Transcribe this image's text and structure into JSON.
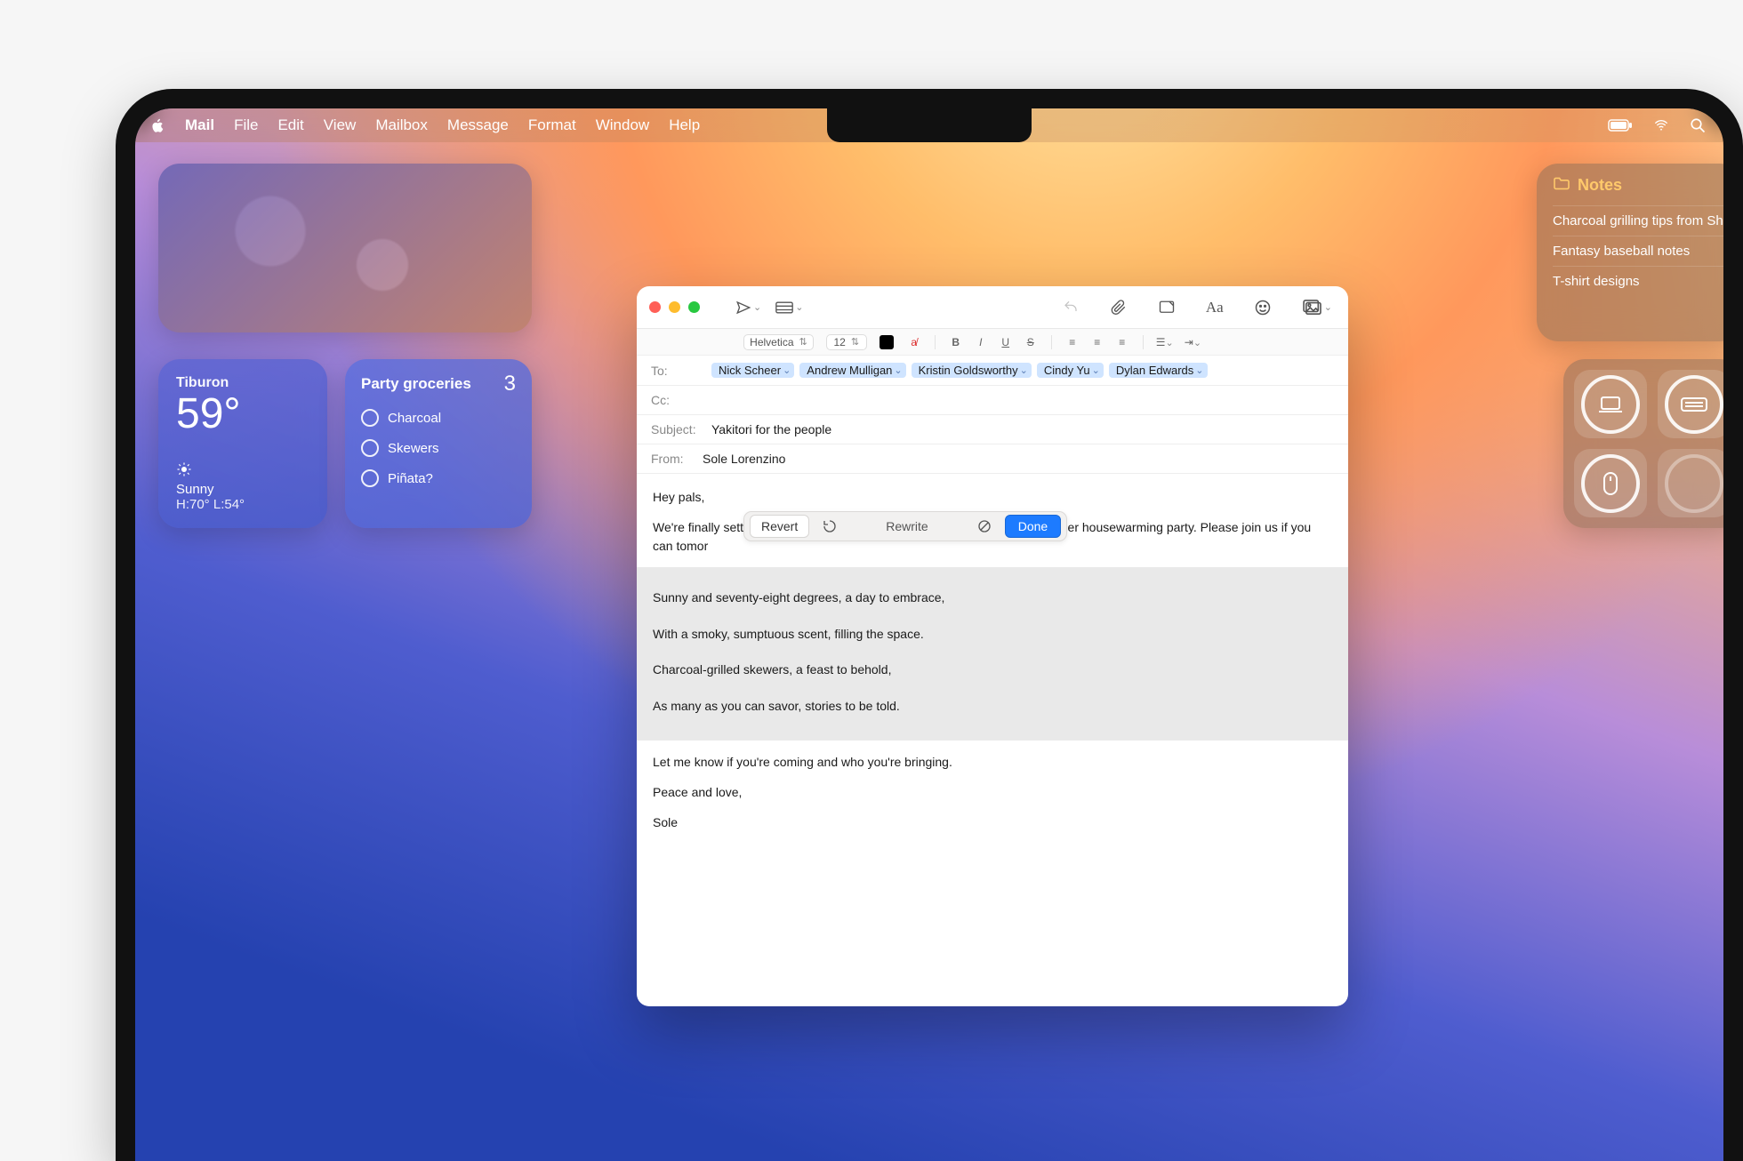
{
  "menubar": {
    "app": "Mail",
    "items": [
      "File",
      "Edit",
      "View",
      "Mailbox",
      "Message",
      "Format",
      "Window",
      "Help"
    ]
  },
  "weather": {
    "location": "Tiburon",
    "temp": "59°",
    "cond": "Sunny",
    "hilo": "H:70° L:54°"
  },
  "reminders": {
    "title": "Party groceries",
    "count": "3",
    "items": [
      "Charcoal",
      "Skewers",
      "Piñata?"
    ]
  },
  "notes": {
    "title": "Notes",
    "items": [
      "Charcoal grilling tips from Sh",
      "Fantasy baseball notes",
      "T-shirt designs"
    ]
  },
  "mail": {
    "font": "Helvetica",
    "size": "12",
    "to_label": "To:",
    "cc_label": "Cc:",
    "subject_label": "Subject:",
    "from_label": "From:",
    "recipients": [
      "Nick Scheer",
      "Andrew Mulligan",
      "Kristin Goldsworthy",
      "Cindy Yu",
      "Dylan Edwards"
    ],
    "subject": "Yakitori for the people",
    "from": "Sole Lorenzino",
    "greeting": "Hey pals,",
    "intro": "We're finally settled into the new place, which means we're ready for a proper housewarming party. Please join us if you can tomor",
    "poem1": "Sunny and seventy-eight degrees, a day to embrace,",
    "poem2": "With a smoky, sumptuous scent, filling the space.",
    "poem3": "Charcoal-grilled skewers, a feast to behold,",
    "poem4": "As many as you can savor, stories to be told.",
    "outro": "Let me know if you're coming and who you're bringing.",
    "signoff": "Peace and love,",
    "signature": "Sole"
  },
  "rewrite": {
    "revert": "Revert",
    "label": "Rewrite",
    "done": "Done"
  }
}
